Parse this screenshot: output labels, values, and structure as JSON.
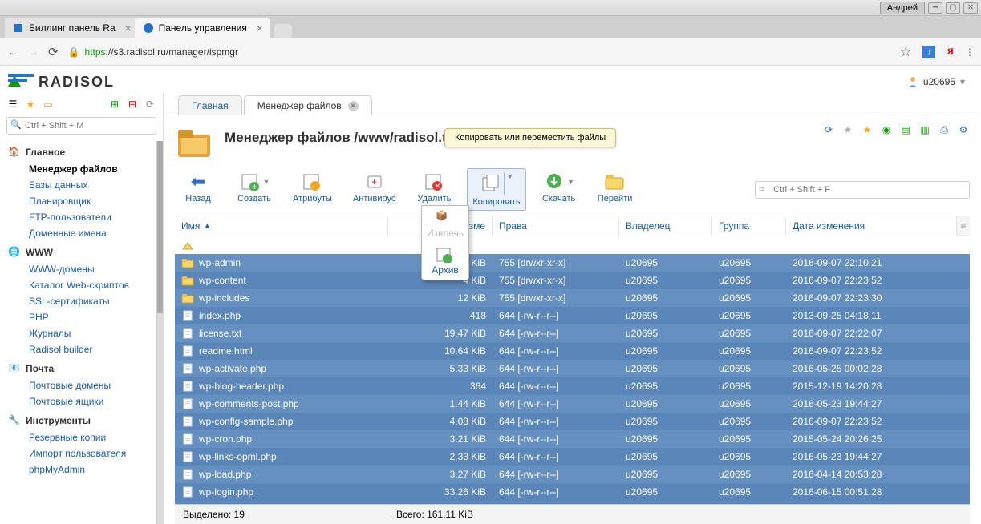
{
  "window": {
    "user": "Андрей"
  },
  "browser": {
    "tabs": [
      {
        "title": "Биллинг панель Ra",
        "active": false
      },
      {
        "title": "Панель управления",
        "active": true
      }
    ],
    "url_https": "https",
    "url_rest": "://s3.radisol.ru/manager/ispmgr"
  },
  "brand": "RADISOL",
  "user": {
    "name": "u20695"
  },
  "side_search_placeholder": "Ctrl + Shift + M",
  "sidebar": [
    {
      "kind": "section",
      "label": "Главное",
      "icon": "home"
    },
    {
      "kind": "item",
      "label": "Менеджер файлов",
      "active": true
    },
    {
      "kind": "item",
      "label": "Базы данных"
    },
    {
      "kind": "item",
      "label": "Планировщик"
    },
    {
      "kind": "item",
      "label": "FTP-пользователи"
    },
    {
      "kind": "item",
      "label": "Доменные имена"
    },
    {
      "kind": "section",
      "label": "WWW",
      "icon": "globe"
    },
    {
      "kind": "item",
      "label": "WWW-домены"
    },
    {
      "kind": "item",
      "label": "Каталог Web-скриптов"
    },
    {
      "kind": "item",
      "label": "SSL-сертификаты"
    },
    {
      "kind": "item",
      "label": "PHP"
    },
    {
      "kind": "item",
      "label": "Журналы"
    },
    {
      "kind": "item",
      "label": "Radisol builder"
    },
    {
      "kind": "section",
      "label": "Почта",
      "icon": "mail"
    },
    {
      "kind": "item",
      "label": "Почтовые домены"
    },
    {
      "kind": "item",
      "label": "Почтовые ящики"
    },
    {
      "kind": "section",
      "label": "Инструменты",
      "icon": "tools"
    },
    {
      "kind": "item",
      "label": "Резервные копии"
    },
    {
      "kind": "item",
      "label": "Импорт пользователя"
    },
    {
      "kind": "item",
      "label": "phpMyAdmin"
    }
  ],
  "tabs": [
    {
      "label": "Главная",
      "active": false
    },
    {
      "label": "Менеджер файлов",
      "active": true,
      "closable": true
    }
  ],
  "page_title": "Менеджер файлов /www/radisol.t",
  "tooltip": "Копировать или переместить файлы",
  "toolbar": {
    "back": "Назад",
    "create": "Создать",
    "attrs": "Атрибуты",
    "av": "Антивирус",
    "delete": "Удалить",
    "copy": "Копировать",
    "download": "Скачать",
    "goto": "Перейти",
    "dropdown": {
      "extract": "Извлечь",
      "archive": "Архив"
    },
    "search_placeholder": "Ctrl + Shift + F"
  },
  "columns": {
    "name": "Имя",
    "size": "Разме",
    "perm": "Права",
    "owner": "Владелец",
    "group": "Группа",
    "date": "Дата изменения"
  },
  "rows": [
    {
      "up": true,
      "name": "",
      "size": "",
      "perm": "",
      "owner": "",
      "group": "",
      "date": ""
    },
    {
      "icon": "folder",
      "name": "wp-admin",
      "size": "4 KiB",
      "perm": "755 [drwxr-xr-x]",
      "owner": "u20695",
      "group": "u20695",
      "date": "2016-09-07 22:10:21"
    },
    {
      "icon": "folder",
      "name": "wp-content",
      "size": "4 KiB",
      "perm": "755 [drwxr-xr-x]",
      "owner": "u20695",
      "group": "u20695",
      "date": "2016-09-07 22:23:52"
    },
    {
      "icon": "folder",
      "name": "wp-includes",
      "size": "12 KiB",
      "perm": "755 [drwxr-xr-x]",
      "owner": "u20695",
      "group": "u20695",
      "date": "2016-09-07 22:23:30"
    },
    {
      "icon": "file",
      "name": "index.php",
      "size": "418",
      "perm": "644 [-rw-r--r--]",
      "owner": "u20695",
      "group": "u20695",
      "date": "2013-09-25 04:18:11"
    },
    {
      "icon": "file",
      "name": "license.txt",
      "size": "19.47 KiB",
      "perm": "644 [-rw-r--r--]",
      "owner": "u20695",
      "group": "u20695",
      "date": "2016-09-07 22:22:07"
    },
    {
      "icon": "file",
      "name": "readme.html",
      "size": "10.64 KiB",
      "perm": "644 [-rw-r--r--]",
      "owner": "u20695",
      "group": "u20695",
      "date": "2016-09-07 22:23:52"
    },
    {
      "icon": "file",
      "name": "wp-activate.php",
      "size": "5.33 KiB",
      "perm": "644 [-rw-r--r--]",
      "owner": "u20695",
      "group": "u20695",
      "date": "2016-05-25 00:02:28"
    },
    {
      "icon": "file",
      "name": "wp-blog-header.php",
      "size": "364",
      "perm": "644 [-rw-r--r--]",
      "owner": "u20695",
      "group": "u20695",
      "date": "2015-12-19 14:20:28"
    },
    {
      "icon": "file",
      "name": "wp-comments-post.php",
      "size": "1.44 KiB",
      "perm": "644 [-rw-r--r--]",
      "owner": "u20695",
      "group": "u20695",
      "date": "2016-05-23 19:44:27"
    },
    {
      "icon": "file",
      "name": "wp-config-sample.php",
      "size": "4.08 KiB",
      "perm": "644 [-rw-r--r--]",
      "owner": "u20695",
      "group": "u20695",
      "date": "2016-09-07 22:23:52"
    },
    {
      "icon": "file",
      "name": "wp-cron.php",
      "size": "3.21 KiB",
      "perm": "644 [-rw-r--r--]",
      "owner": "u20695",
      "group": "u20695",
      "date": "2015-05-24 20:26:25"
    },
    {
      "icon": "file",
      "name": "wp-links-opml.php",
      "size": "2.33 KiB",
      "perm": "644 [-rw-r--r--]",
      "owner": "u20695",
      "group": "u20695",
      "date": "2016-05-23 19:44:27"
    },
    {
      "icon": "file",
      "name": "wp-load.php",
      "size": "3.27 KiB",
      "perm": "644 [-rw-r--r--]",
      "owner": "u20695",
      "group": "u20695",
      "date": "2016-04-14 20:53:28"
    },
    {
      "icon": "file",
      "name": "wp-login.php",
      "size": "33.26 KiB",
      "perm": "644 [-rw-r--r--]",
      "owner": "u20695",
      "group": "u20695",
      "date": "2016-06-15 00:51:28"
    }
  ],
  "status": {
    "selected": "Выделено: 19",
    "total": "Всего: 161.11 KiB"
  }
}
